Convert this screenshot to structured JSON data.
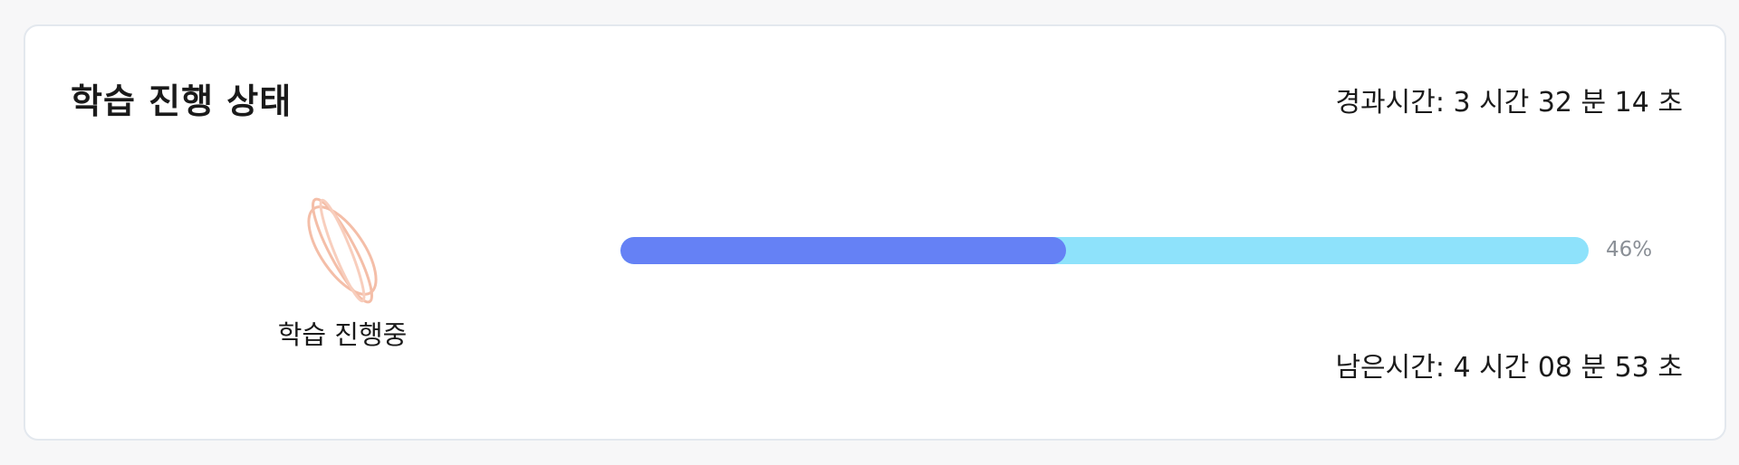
{
  "card": {
    "title": "학습 진행 상태",
    "elapsed": "경과시간: 3 시간 32 분 14 초",
    "remaining": "남은시간: 4 시간 08 분 53 초"
  },
  "status": {
    "icon": "spinner-icon",
    "label": "학습 진행중"
  },
  "progress": {
    "value": 0.46,
    "percent_label": "46%"
  },
  "colors": {
    "accent": "#6581f5",
    "track": "#8ee2fb",
    "icon": "#f0a080",
    "muted_text": "#8a8f96"
  }
}
